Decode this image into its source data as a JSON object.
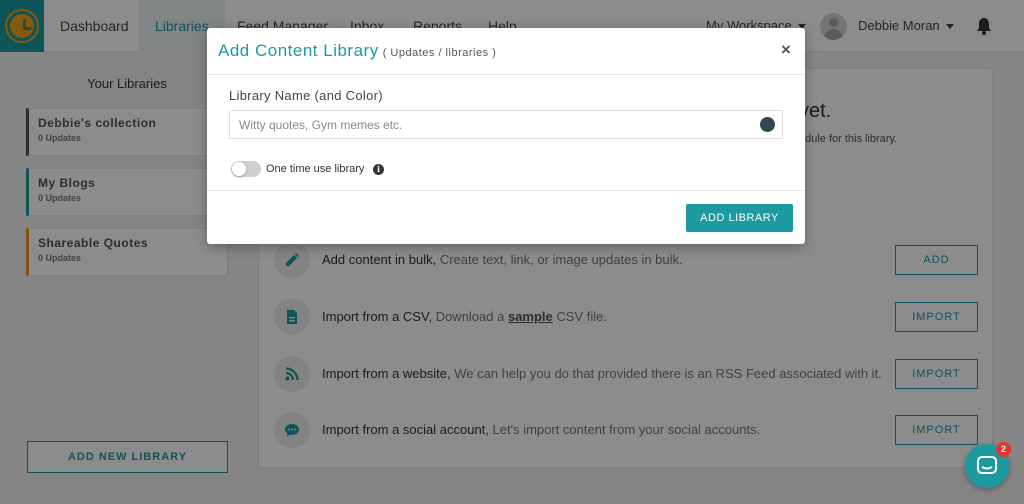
{
  "nav": {
    "items": [
      "Dashboard",
      "Libraries",
      "Feed Manager",
      "Inbox",
      "Reports",
      "Help"
    ],
    "active": "Libraries",
    "workspace": "My Workspace",
    "user_name": "Debbie Moran"
  },
  "sidebar": {
    "title": "Your Libraries",
    "libraries": [
      {
        "name": "Debbie's collection",
        "count": "0 Updates",
        "color": "#555555"
      },
      {
        "name": "My Blogs",
        "count": "0 Updates",
        "color": "#1c9aa0"
      },
      {
        "name": "Shareable Quotes",
        "count": "0 Updates",
        "color": "#f0921e"
      }
    ],
    "add_button": "ADD NEW LIBRARY"
  },
  "main": {
    "empty_title": "yet.",
    "empty_subtitle": "edule for this library.",
    "options": [
      {
        "title": "Add content in bulk,",
        "desc": "Create text, link, or image updates in bulk.",
        "button": "ADD",
        "icon": "pencil-icon"
      },
      {
        "title": "Import from a CSV,",
        "desc_before": "Download a",
        "link": "sample",
        "desc_after": "CSV file.",
        "button": "IMPORT",
        "icon": "file-icon"
      },
      {
        "title": "Import from a website,",
        "desc": "We can help you do that provided there is an RSS Feed associated with it.",
        "button": "IMPORT",
        "icon": "rss-icon"
      },
      {
        "title": "Import from a social account,",
        "desc": "Let's import content from your social accounts.",
        "button": "IMPORT",
        "icon": "chat-bubble-icon"
      }
    ]
  },
  "modal": {
    "title": "Add Content Library",
    "subtitle": "( Updates / libraries )",
    "close": "×",
    "field_label": "Library Name (and Color)",
    "input_placeholder": "Witty quotes, Gym memes etc.",
    "input_value": "",
    "selected_color": "#2e4a50",
    "toggle_label": "One time use library",
    "toggle_on": false,
    "info_symbol": "i",
    "submit": "ADD LIBRARY"
  },
  "chat": {
    "badge": "2"
  },
  "colors": {
    "accent": "#1c9aa0",
    "overlay": "rgba(0,0,0,0.45)"
  }
}
